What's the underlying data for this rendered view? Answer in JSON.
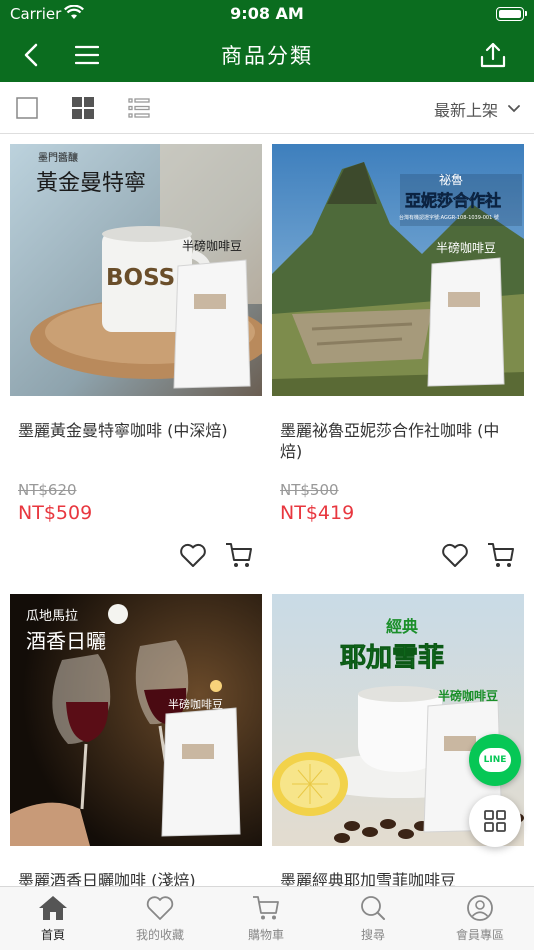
{
  "status_bar": {
    "carrier": "Carrier",
    "time": "9:08 AM"
  },
  "nav": {
    "title": "商品分類"
  },
  "filter": {
    "sort_label": "最新上架"
  },
  "products": [
    {
      "name": "墨麗黃金曼特寧咖啡 (中深焙)",
      "old_price": "NT$620",
      "price": "NT$509",
      "image": {
        "brand_small": "墨門醬釀",
        "title": "黃金曼特寧",
        "mug_text": "BOSS",
        "bag_label": "半磅咖啡豆"
      }
    },
    {
      "name": "墨麗祕魯亞妮莎合作社咖啡 (中焙)",
      "old_price": "NT$500",
      "price": "NT$419",
      "image": {
        "title_small": "祕魯",
        "title": "亞妮莎合作社",
        "subtitle": "台灣有機認證字號:AGGR-108-1039-001 號",
        "bag_label": "半磅咖啡豆"
      }
    },
    {
      "name": "墨麗酒香日曬咖啡 (淺焙)",
      "image": {
        "title_small": "瓜地馬拉",
        "title": "酒香日曬",
        "bag_label": "半磅咖啡豆"
      }
    },
    {
      "name": "墨麗經典耶加雪菲咖啡豆",
      "image": {
        "title_small": "經典",
        "title": "耶加雪菲",
        "bag_label": "半磅咖啡豆"
      }
    }
  ],
  "fab": {
    "line_label": "LINE"
  },
  "tabs": [
    {
      "label": "首頁",
      "icon": "home-icon",
      "active": true
    },
    {
      "label": "我的收藏",
      "icon": "heart-icon"
    },
    {
      "label": "購物車",
      "icon": "cart-icon"
    },
    {
      "label": "搜尋",
      "icon": "search-icon"
    },
    {
      "label": "會員專區",
      "icon": "user-icon"
    }
  ],
  "colors": {
    "brand_green": "#0b6d1f",
    "price_red": "#e8373f",
    "line_green": "#06c755"
  }
}
